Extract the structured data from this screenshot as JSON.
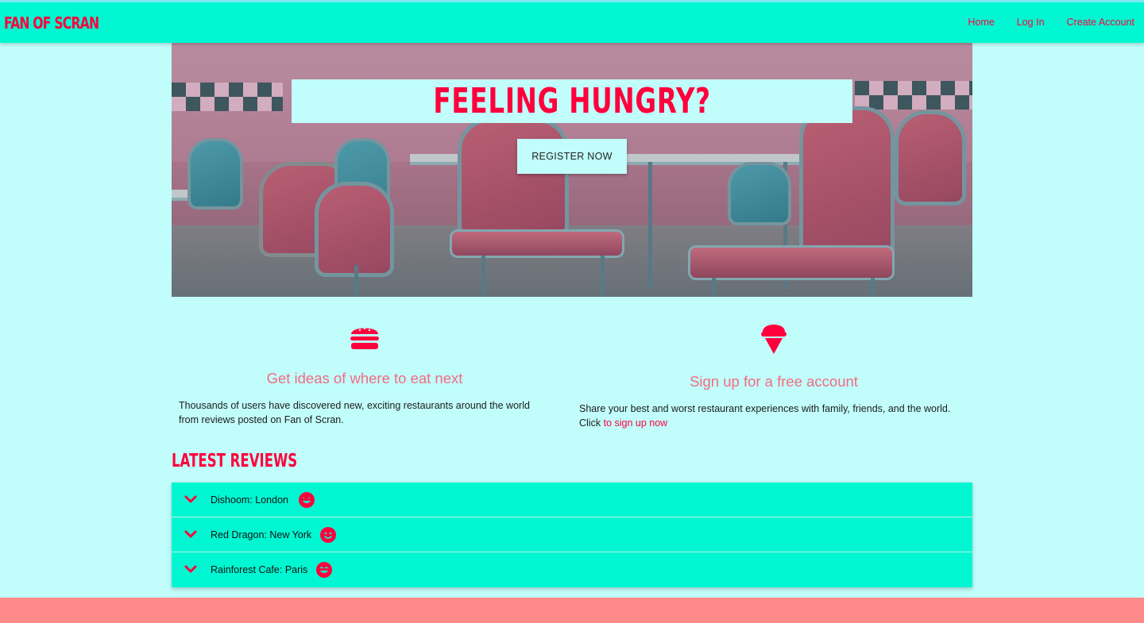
{
  "brand": "Fan of Scran",
  "nav": {
    "home": "Home",
    "login": "Log In",
    "create_account": "Create Account"
  },
  "hero": {
    "title": "Feeling Hungry?",
    "button": "REGISTER NOW"
  },
  "features": [
    {
      "icon": "hamburger-icon",
      "heading": "Get ideas of where to eat next",
      "text": "Thousands of users have discovered new, exciting restaurants around the world from reviews posted on Fan of Scran."
    },
    {
      "icon": "ice-cream-icon",
      "heading": "Sign up for a free account",
      "text": "Share your best and worst restaurant experiences with family, friends, and the world. Click ",
      "link": "to sign up now"
    }
  ],
  "reviews": {
    "heading": "Latest Reviews",
    "items": [
      {
        "name": "Dishoom:",
        "city": "London",
        "face": "grin-stars-face-icon"
      },
      {
        "name": "Red Dragon:",
        "city": "New York",
        "face": "smile-face-icon"
      },
      {
        "name": "Rainforest Cafe:",
        "city": "Paris",
        "face": "grin-tongue-face-icon"
      }
    ]
  },
  "colors": {
    "accent": "#ff003c",
    "nav_bg": "#00f7d2",
    "page_bg": "#c1fdfb",
    "heading_pink": "#f26c82",
    "footer_bg": "#ff8a8a"
  }
}
